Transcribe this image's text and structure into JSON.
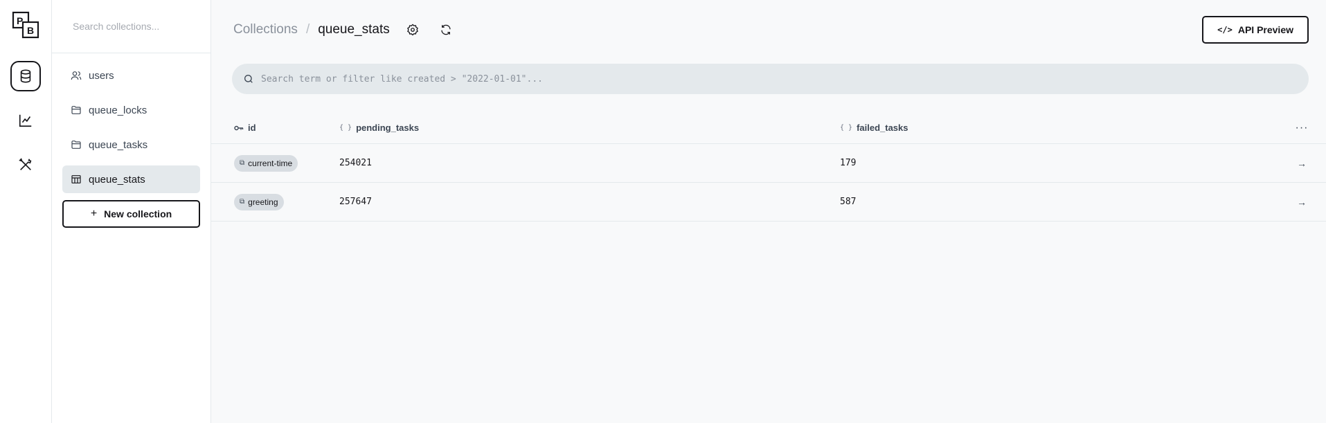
{
  "rail": {
    "logo_top": "P",
    "logo_bottom": "B"
  },
  "sidebar": {
    "search_placeholder": "Search collections...",
    "items": [
      {
        "label": "users",
        "icon": "users-icon"
      },
      {
        "label": "queue_locks",
        "icon": "folder-icon"
      },
      {
        "label": "queue_tasks",
        "icon": "folder-icon"
      },
      {
        "label": "queue_stats",
        "icon": "table-icon"
      }
    ],
    "new_collection_label": "New collection"
  },
  "header": {
    "breadcrumb_root": "Collections",
    "breadcrumb_sep": "/",
    "current": "queue_stats",
    "api_preview_label": "API Preview"
  },
  "search": {
    "placeholder": "Search term or filter like created > \"2022-01-01\"..."
  },
  "table": {
    "columns": [
      {
        "label": "id",
        "icon": "key-icon"
      },
      {
        "label": "pending_tasks",
        "icon": "json-icon"
      },
      {
        "label": "failed_tasks",
        "icon": "json-icon"
      }
    ],
    "rows": [
      {
        "id": "current-time",
        "pending_tasks": "254021",
        "failed_tasks": "179"
      },
      {
        "id": "greeting",
        "pending_tasks": "257647",
        "failed_tasks": "587"
      }
    ]
  }
}
